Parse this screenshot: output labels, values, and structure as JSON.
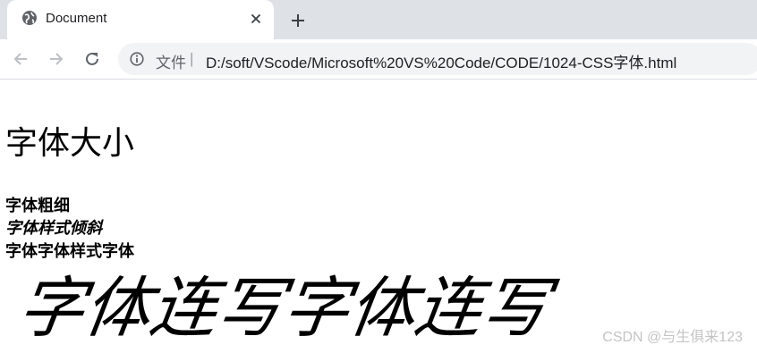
{
  "tab": {
    "title": "Document",
    "favicon_icon": "globe-icon",
    "close_icon": "close-icon"
  },
  "new_tab_icon": "plus-icon",
  "toolbar": {
    "back_icon": "arrow-left-icon",
    "forward_icon": "arrow-right-icon",
    "reload_icon": "reload-icon",
    "info_icon": "info-icon",
    "security_label": "文件",
    "separator": "|",
    "url": "D:/soft/VScode/Microsoft%20VS%20Code/CODE/1024-CSS字体.html"
  },
  "content": {
    "heading_font_size": "字体大小",
    "line_font_weight": "字体粗细",
    "line_font_style": "字体样式倾斜",
    "line_font_combined": "字体字体样式字体",
    "big_text": "字体连写字体连写"
  },
  "watermark": "CSDN @与生俱来123",
  "colors": {
    "tabstrip_bg": "#dee1e6",
    "omnibox_bg": "#f1f3f4",
    "icon_gray": "#5f6368",
    "text": "#202124"
  }
}
